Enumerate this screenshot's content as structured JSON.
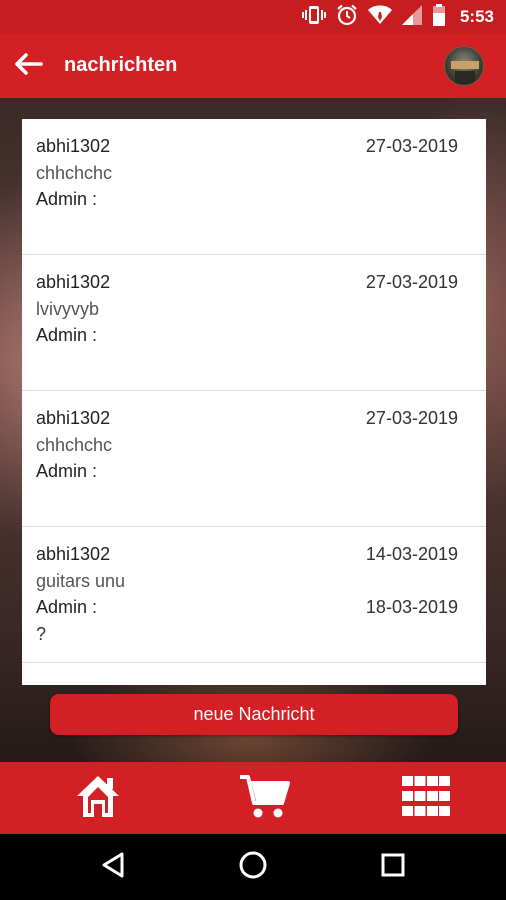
{
  "status_bar": {
    "time": "5:53",
    "icons": [
      "vibrate-icon",
      "alarm-icon",
      "wifi-icon",
      "cell-signal-icon",
      "battery-icon"
    ]
  },
  "app_bar": {
    "title": "nachrichten",
    "back_icon": "arrow-left-icon"
  },
  "messages": [
    {
      "user": "abhi1302",
      "date": "27-03-2019",
      "text": "chhchchc",
      "admin_label": "Admin :",
      "reply_date": "",
      "reply_text": ""
    },
    {
      "user": "abhi1302",
      "date": "27-03-2019",
      "text": "lvivyvyb",
      "admin_label": "Admin :",
      "reply_date": "",
      "reply_text": ""
    },
    {
      "user": "abhi1302",
      "date": "27-03-2019",
      "text": "chhchchc",
      "admin_label": "Admin :",
      "reply_date": "",
      "reply_text": ""
    },
    {
      "user": "abhi1302",
      "date": "14-03-2019",
      "text": "guitars unu",
      "admin_label": "Admin :",
      "reply_date": "18-03-2019",
      "reply_text": "?"
    }
  ],
  "new_message_button": "neue Nachricht",
  "bottom_nav": {
    "items": [
      "home-icon",
      "cart-icon",
      "grid-menu-icon"
    ]
  },
  "system_nav": {
    "items": [
      "back-triangle-icon",
      "home-circle-icon",
      "recents-square-icon"
    ]
  },
  "colors": {
    "accent": "#d32024",
    "status_bar": "#c81d20"
  }
}
